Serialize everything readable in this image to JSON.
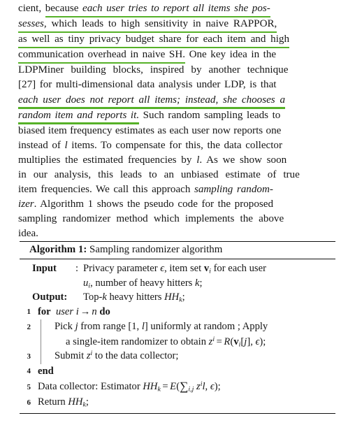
{
  "document": {
    "kind": "academic-paper-excerpt",
    "colors": {
      "highlight_underline": "#56b128",
      "text": "#161616",
      "rule": "#111111",
      "loop_bar": "#8a8a8a",
      "page_background": "#ffffff"
    }
  },
  "paragraph": {
    "lines": [
      {
        "id": "p-line-1",
        "segments": [
          {
            "text": "cient, ",
            "style": "roman",
            "underlined": false
          },
          {
            "text": "because ",
            "style": "roman",
            "underlined": true
          },
          {
            "text": "each user tries to report all items she pos-",
            "style": "italic",
            "underlined": true
          }
        ]
      },
      {
        "id": "p-line-2",
        "segments": [
          {
            "text": "sesses",
            "style": "italic",
            "underlined": true
          },
          {
            "text": ", which leads to high sensitivity in naive RAPPOR,",
            "style": "roman",
            "underlined": true
          }
        ]
      },
      {
        "id": "p-line-3",
        "segments": [
          {
            "text": "as well as tiny privacy budget share for each item and high",
            "style": "roman",
            "underlined": true
          }
        ]
      },
      {
        "id": "p-line-4",
        "segments": [
          {
            "text": "communication overhead in naive SH.",
            "style": "roman",
            "underlined": true
          },
          {
            "text": " One key idea in the",
            "style": "roman",
            "underlined": false
          }
        ]
      },
      {
        "id": "p-line-5",
        "segments": [
          {
            "text": "LDPMiner building blocks, inspired by another technique",
            "style": "roman",
            "underlined": false
          }
        ]
      },
      {
        "id": "p-line-6",
        "segments": [
          {
            "text": "[27] for multi-dimensional data analysis under LDP, is that",
            "style": "roman",
            "underlined": false
          }
        ]
      },
      {
        "id": "p-line-7",
        "segments": [
          {
            "text": "each user does not report all items; instead, she chooses a",
            "style": "italic",
            "underlined": true
          }
        ]
      },
      {
        "id": "p-line-8",
        "segments": [
          {
            "text": "random item and reports it.",
            "style": "italic",
            "underlined": true
          },
          {
            "text": " Such random sampling leads to",
            "style": "roman",
            "underlined": false
          }
        ]
      },
      {
        "id": "p-line-9",
        "segments": [
          {
            "text": "biased item frequency estimates as each user now reports one",
            "style": "roman",
            "underlined": false
          }
        ]
      },
      {
        "id": "p-line-10",
        "segments": [
          {
            "text": "instead of ",
            "style": "roman",
            "underlined": false
          },
          {
            "text": "l",
            "style": "italic",
            "underlined": false
          },
          {
            "text": " items. To compensate for this, the data collector",
            "style": "roman",
            "underlined": false
          }
        ]
      },
      {
        "id": "p-line-11",
        "segments": [
          {
            "text": "multiplies the estimated frequencies by ",
            "style": "roman",
            "underlined": false
          },
          {
            "text": "l",
            "style": "italic",
            "underlined": false
          },
          {
            "text": ". As we show soon",
            "style": "roman",
            "underlined": false
          }
        ]
      },
      {
        "id": "p-line-12",
        "segments": [
          {
            "text": "in our analysis, this leads to an unbiased estimate of true",
            "style": "roman",
            "underlined": false
          }
        ]
      },
      {
        "id": "p-line-13",
        "segments": [
          {
            "text": "item frequencies. We call this approach ",
            "style": "roman",
            "underlined": false
          },
          {
            "text": "sampling random-",
            "style": "italic",
            "underlined": false
          }
        ]
      },
      {
        "id": "p-line-14",
        "segments": [
          {
            "text": "izer",
            "style": "italic",
            "underlined": false
          },
          {
            "text": ". Algorithm 1 shows the pseudo code for the proposed",
            "style": "roman",
            "underlined": false
          }
        ]
      },
      {
        "id": "p-line-15",
        "segments": [
          {
            "text": "sampling randomizer method which implements the above",
            "style": "roman",
            "underlined": false
          }
        ]
      },
      {
        "id": "p-line-16",
        "segments": [
          {
            "text": "idea.",
            "style": "roman",
            "underlined": false
          }
        ]
      }
    ],
    "full_text": "cient, because each user tries to report all items she possesses, which leads to high sensitivity in naive RAPPOR, as well as tiny privacy budget share for each item and high communication overhead in naive SH. One key idea in the LDPMiner building blocks, inspired by another technique [27] for multi-dimensional data analysis under LDP, is that each user does not report all items; instead, she chooses a random item and reports it. Such random sampling leads to biased item frequency estimates as each user now reports one instead of l items. To compensate for this, the data collector multiplies the estimated frequencies by l. As we show soon in our analysis, this leads to an unbiased estimate of true item frequencies. We call this approach sampling randomizer. Algorithm 1 shows the pseudo code for the proposed sampling randomizer method which implements the above idea.",
    "highlighted_phrases": [
      "because each user tries to report all items she possesses, which leads to high sensitivity in naive RAPPOR, as well as tiny privacy budget share for each item and high communication overhead in naive SH.",
      "each user does not report all items; instead, she chooses a random item and reports it."
    ],
    "citation": "[27]"
  },
  "algorithm": {
    "caption_keyword": "Algorithm 1:",
    "caption_title": "Sampling randomizer algorithm",
    "input_label": "Input",
    "input_colon": ":",
    "input_line1_a": "Privacy parameter ",
    "input_line1_eps": "ϵ",
    "input_line1_b": ", item set ",
    "input_line1_v": "v",
    "input_line1_vsub": "i",
    "input_line1_c": " for each user",
    "input_line2_u": "u",
    "input_line2_usub": "i",
    "input_line2_a": ", number of heavy hitters ",
    "input_line2_k": "k",
    "input_line2_semi": ";",
    "output_label": "Output:",
    "output_a": "Top-",
    "output_k": "k",
    "output_b": " heavy hitters ",
    "output_hh": "HH",
    "output_hhsub": "k",
    "output_semi": ";",
    "steps": [
      {
        "num": "1",
        "id": "step-for",
        "bar": false,
        "parts": {
          "kw_for": "for",
          "loop_var": "user i",
          "arrow": "→",
          "loop_n": "n",
          "kw_do": "do"
        }
      },
      {
        "num": "2",
        "id": "step-pick",
        "bar": true,
        "parts": {
          "a": "Pick ",
          "j": "j",
          "b": " from range [1, ",
          "l": "l",
          "c": "] uniformly at random ; Apply",
          "cont_a": "a single-item randomizer to obtain ",
          "cont_z": "z",
          "cont_zsup": "i",
          "cont_eq": "=",
          "cont_R": "R",
          "cont_open": "(",
          "cont_v": "v",
          "cont_vsub": "i",
          "cont_bracket": "[",
          "cont_j": "j",
          "cont_bracket2": "]",
          "cont_comma": ", ",
          "cont_eps": "ϵ",
          "cont_close": ");"
        }
      },
      {
        "num": "3",
        "id": "step-submit",
        "bar": true,
        "parts": {
          "a": "Submit ",
          "z": "z",
          "zsup": "i",
          "b": " to the data collector;"
        }
      },
      {
        "num": "4",
        "id": "step-end",
        "bar": false,
        "parts": {
          "kw_end": "end"
        }
      },
      {
        "num": "5",
        "id": "step-estimator",
        "bar": false,
        "parts": {
          "a": "Data collector: Estimator ",
          "hh": "HH",
          "hhsub": "k",
          "eq": "=",
          "E": "E",
          "open": "(",
          "sum": "∑",
          "sumsub": "i,j",
          "z": "z",
          "zsup": "i",
          "l": "l",
          "comma": ", ",
          "eps": "ϵ",
          "close": ");"
        }
      },
      {
        "num": "6",
        "id": "step-return",
        "bar": false,
        "parts": {
          "a": "Return ",
          "hh": "HH",
          "hhsub": "k",
          "semi": ";"
        }
      }
    ]
  }
}
